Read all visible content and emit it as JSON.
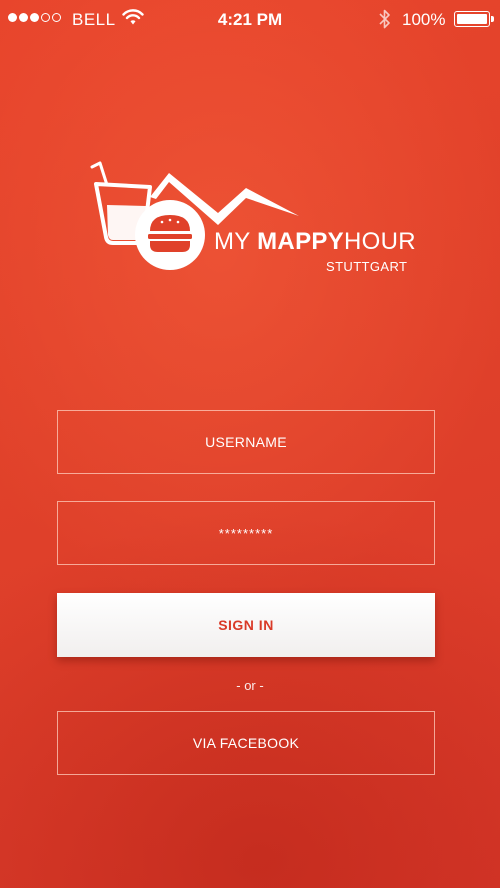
{
  "status_bar": {
    "signal_full": 3,
    "signal_total": 5,
    "carrier": "BELL",
    "time": "4:21 PM",
    "battery_percent": "100%",
    "battery_level": 1.0
  },
  "logo": {
    "title_light_1": "MY ",
    "title_bold": "MAPPY",
    "title_light_2": "HOUR",
    "city": "STUTTGART",
    "icons": [
      "drink-icon",
      "mountain-icon",
      "burger-icon"
    ]
  },
  "form": {
    "username_placeholder": "USERNAME",
    "password_value": "*********",
    "signin_label": "SIGN IN",
    "or_text": "- or -",
    "facebook_label": "VIA FACEBOOK"
  },
  "colors": {
    "background": "#e0412a",
    "accent_text": "#d93a27",
    "button_bg": "#ffffff"
  }
}
